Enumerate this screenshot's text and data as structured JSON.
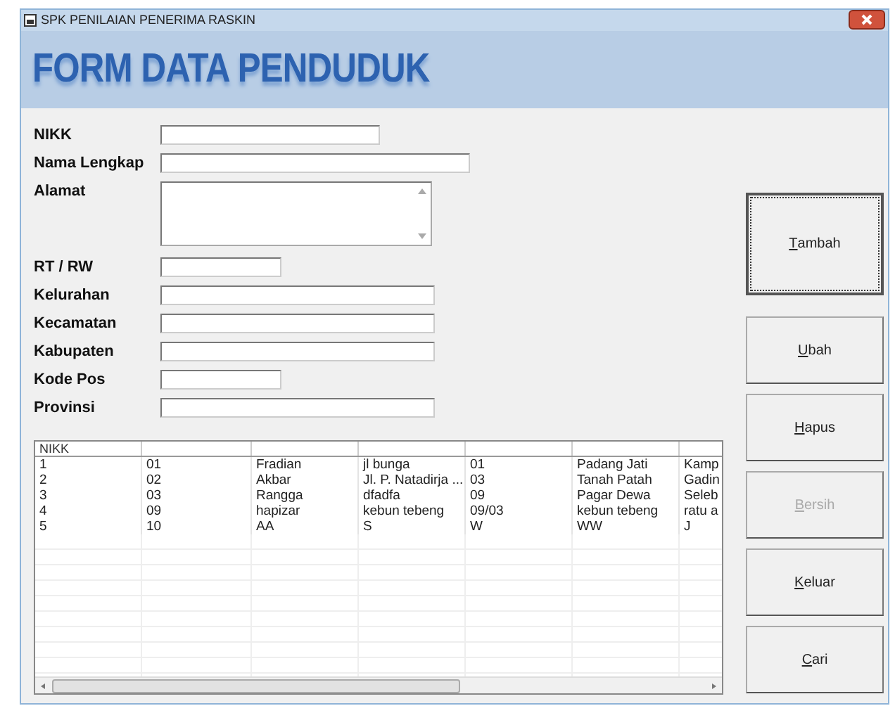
{
  "window": {
    "title": "SPK PENILAIAN PENERIMA RASKIN"
  },
  "header": {
    "title": "FORM DATA PENDUDUK"
  },
  "fields": [
    {
      "label": "NIKK",
      "kind": "medium"
    },
    {
      "label": "Nama Lengkap",
      "kind": "long"
    },
    {
      "label": "Alamat",
      "kind": "memo"
    },
    {
      "label": "RT / RW",
      "kind": "short"
    },
    {
      "label": "Kelurahan",
      "kind": "wide"
    },
    {
      "label": "Kecamatan",
      "kind": "wide"
    },
    {
      "label": "Kabupaten",
      "kind": "wide"
    },
    {
      "label": "Kode Pos",
      "kind": "short"
    },
    {
      "label": "Provinsi",
      "kind": "wide"
    }
  ],
  "table": {
    "header": "NIKK",
    "rows": [
      [
        "1",
        "01",
        "Fradian",
        "jl bunga",
        "01",
        "Padang Jati",
        "Kamp"
      ],
      [
        "2",
        "02",
        "Akbar",
        "Jl. P. Natadirja ...",
        "03",
        "Tanah Patah",
        "Gadin"
      ],
      [
        "3",
        "03",
        "Rangga",
        "dfadfa",
        "09",
        "Pagar Dewa",
        "Seleb"
      ],
      [
        "4",
        "09",
        "hapizar",
        "kebun tebeng",
        "09/03",
        "kebun tebeng",
        "ratu a"
      ],
      [
        "5",
        "10",
        "AA",
        "S",
        "W",
        "WW",
        "J"
      ]
    ]
  },
  "buttons": [
    {
      "label": "Tambah",
      "focused": true,
      "disabled": false
    },
    {
      "label": "Ubah",
      "focused": false,
      "disabled": false
    },
    {
      "label": "Hapus",
      "focused": false,
      "disabled": false
    },
    {
      "label": "Bersih",
      "focused": false,
      "disabled": true
    },
    {
      "label": "Keluar",
      "focused": false,
      "disabled": false
    },
    {
      "label": "Cari",
      "focused": false,
      "disabled": false
    }
  ]
}
